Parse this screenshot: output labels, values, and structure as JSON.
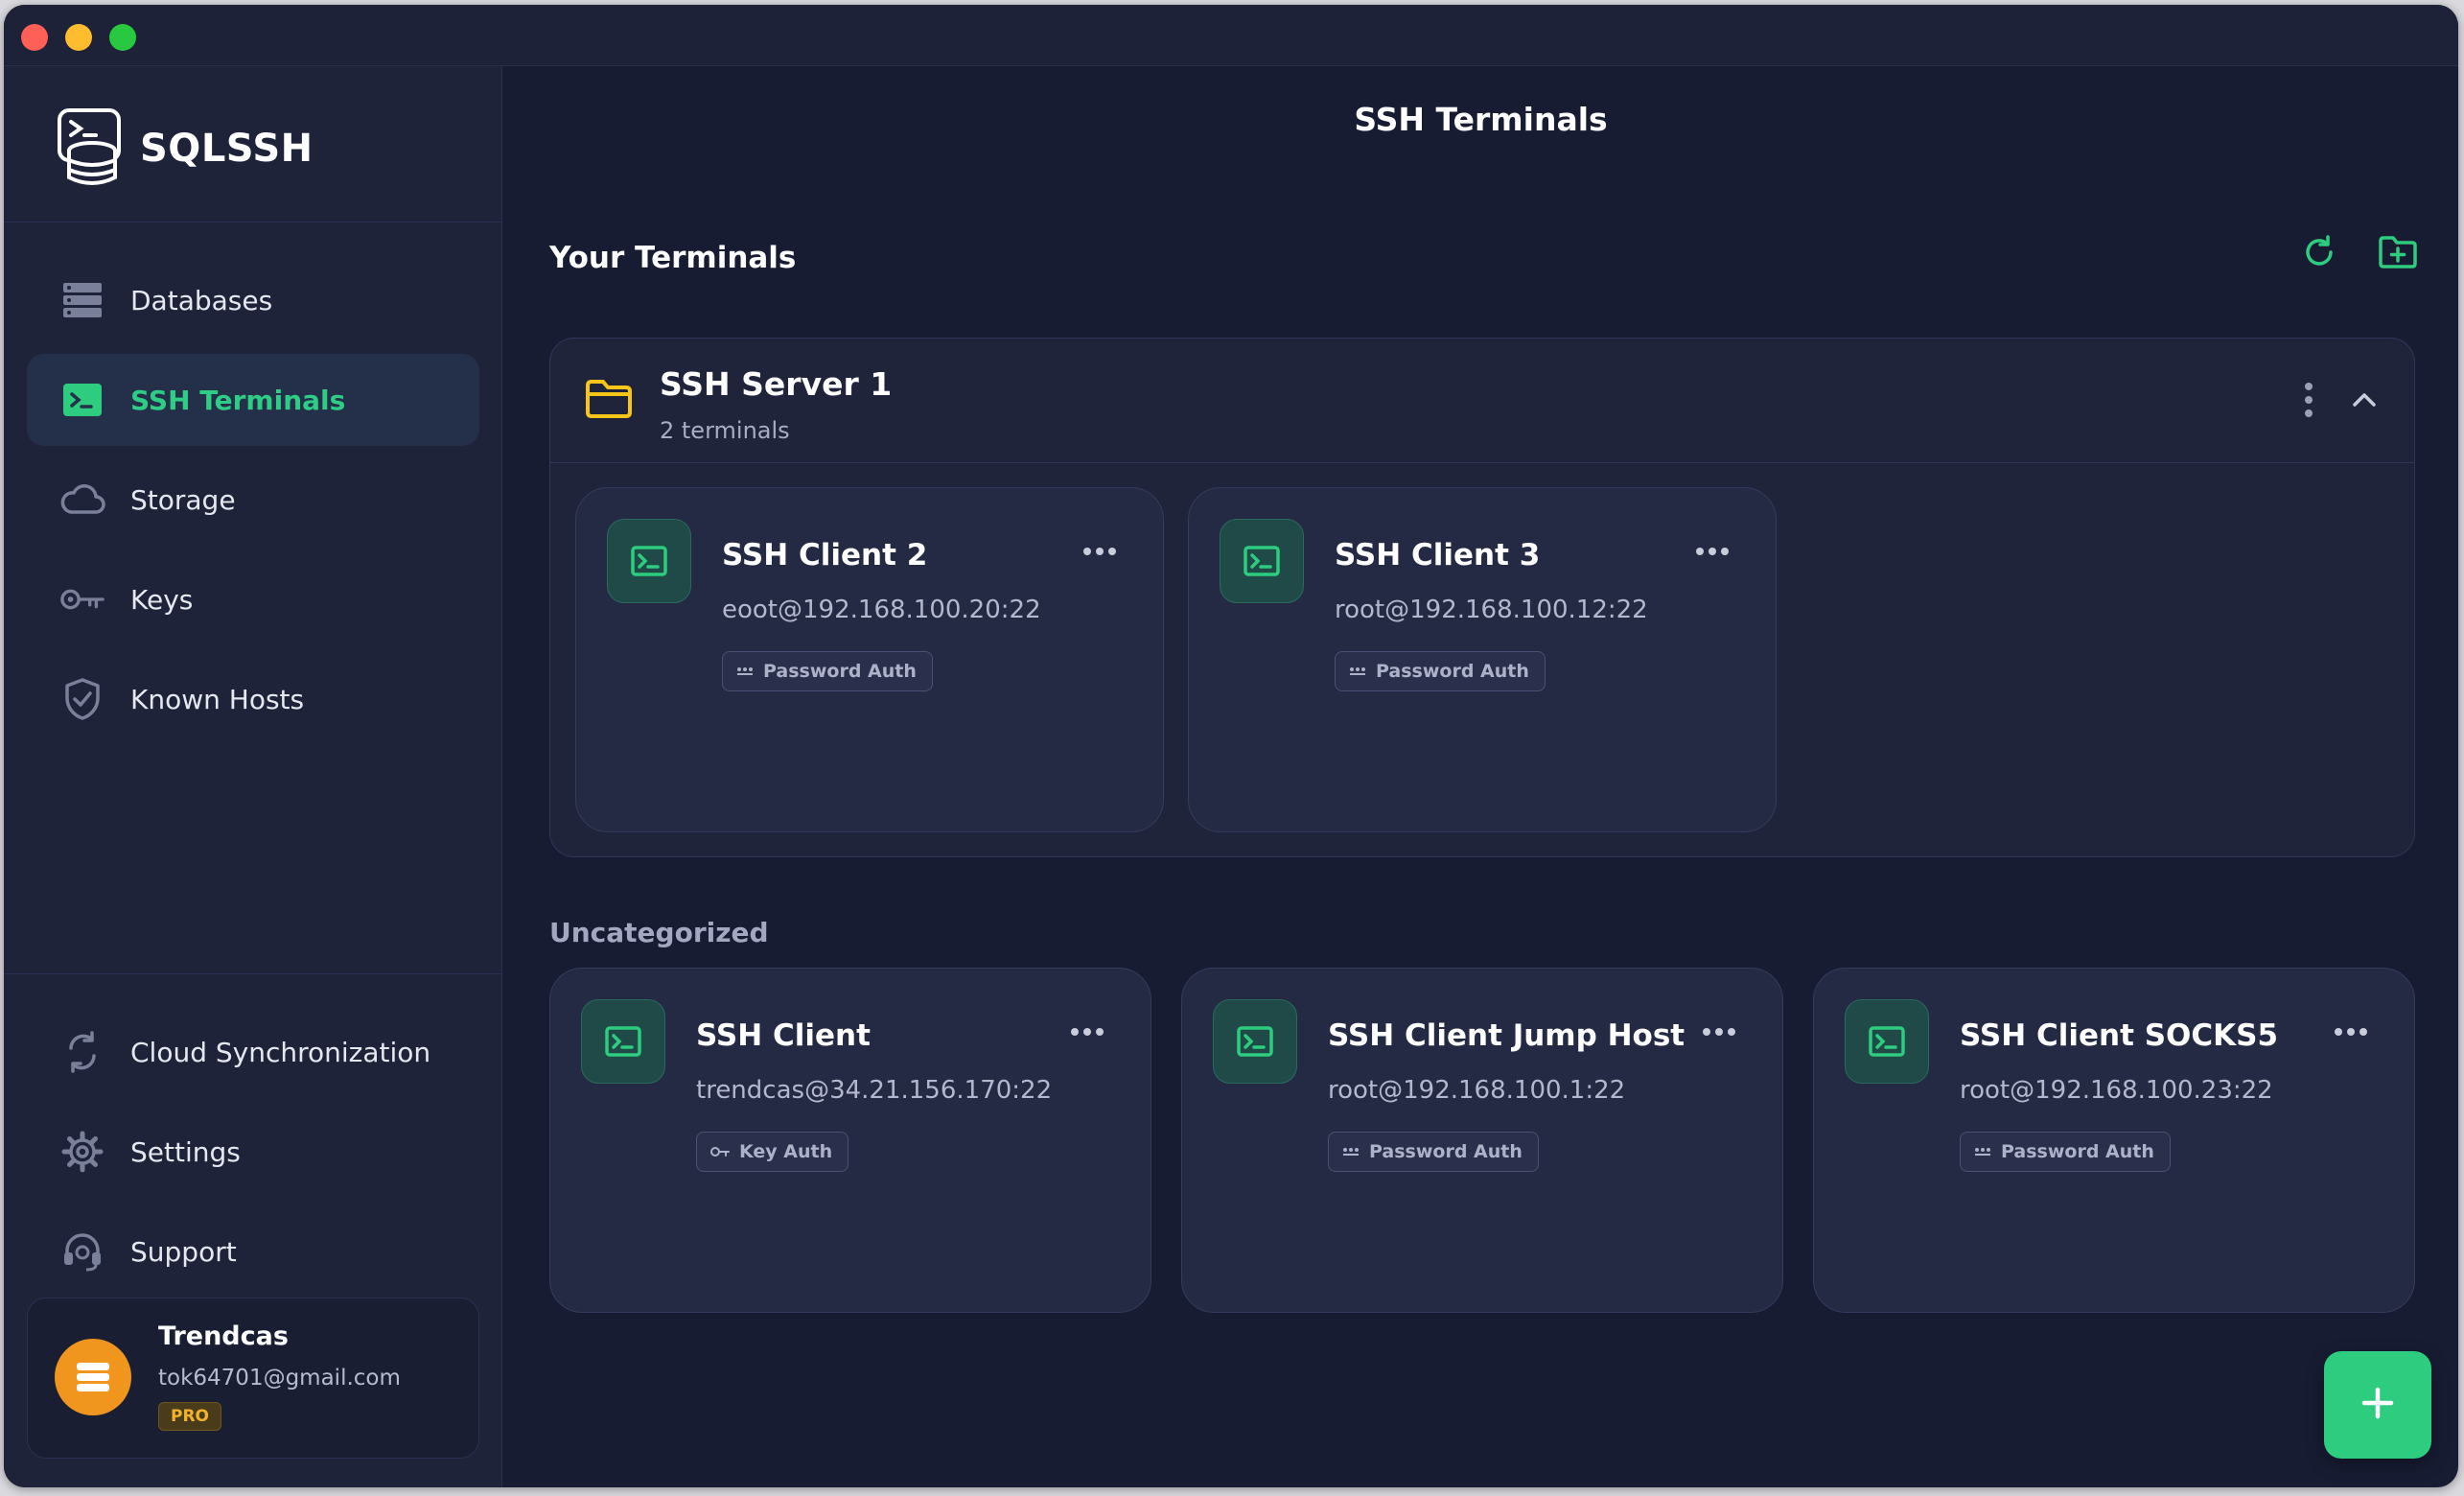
{
  "app": {
    "brand": "SQLSSH"
  },
  "sidebar": {
    "top_items": [
      {
        "label": "Databases",
        "icon": "database-icon"
      },
      {
        "label": "SSH Terminals",
        "icon": "terminal-icon",
        "active": true
      },
      {
        "label": "Storage",
        "icon": "cloud-icon"
      },
      {
        "label": "Keys",
        "icon": "key-icon"
      },
      {
        "label": "Known Hosts",
        "icon": "shield-check-icon"
      }
    ],
    "bottom_items": [
      {
        "label": "Cloud Synchronization",
        "icon": "sync-icon"
      },
      {
        "label": "Settings",
        "icon": "gear-icon"
      },
      {
        "label": "Support",
        "icon": "headset-icon"
      }
    ]
  },
  "user": {
    "name": "Trendcas",
    "email": "tok64701@gmail.com",
    "badge": "PRO"
  },
  "main": {
    "title": "SSH Terminals",
    "section_title": "Your Terminals",
    "group": {
      "name": "SSH Server 1",
      "count_label": "2 terminals",
      "terminals": [
        {
          "name": "SSH Client 2",
          "host": "eoot@192.168.100.20:22",
          "auth": "Password Auth",
          "auth_icon": "password-dots-icon"
        },
        {
          "name": "SSH Client 3",
          "host": "root@192.168.100.12:22",
          "auth": "Password Auth",
          "auth_icon": "password-dots-icon"
        }
      ]
    },
    "uncategorized_title": "Uncategorized",
    "uncategorized": [
      {
        "name": "SSH Client",
        "host": "trendcas@34.21.156.170:22",
        "auth": "Key Auth",
        "auth_icon": "key-icon"
      },
      {
        "name": "SSH Client Jump Host",
        "host": "root@192.168.100.1:22",
        "auth": "Password Auth",
        "auth_icon": "password-dots-icon"
      },
      {
        "name": "SSH Client SOCKS5",
        "host": "root@192.168.100.23:22",
        "auth": "Password Auth",
        "auth_icon": "password-dots-icon"
      }
    ]
  },
  "colors": {
    "accent": "#2ecc7f",
    "folder": "#f5c518",
    "background": "#181c33",
    "sidebar": "#1f2339",
    "avatar": "#f0961e"
  }
}
